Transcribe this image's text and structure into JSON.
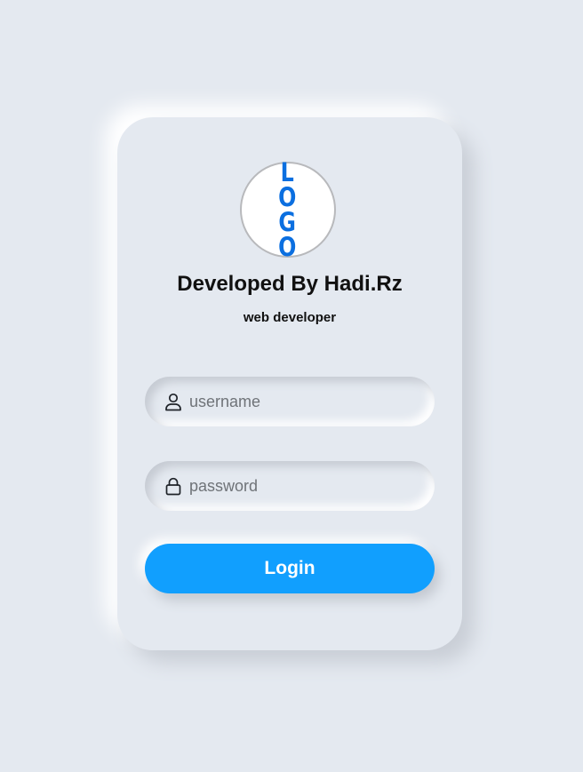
{
  "logo": {
    "text": "LOGO",
    "color": "#0b6fe0"
  },
  "header": {
    "title": "Developed By Hadi.Rz",
    "subtitle": "web developer"
  },
  "form": {
    "username": {
      "value": "",
      "placeholder": "username",
      "icon": "user-icon"
    },
    "password": {
      "value": "",
      "placeholder": "password",
      "icon": "lock-icon"
    },
    "login_label": "Login"
  },
  "colors": {
    "background": "#e4e9f0",
    "accent": "#119ffe",
    "text": "#111111"
  }
}
